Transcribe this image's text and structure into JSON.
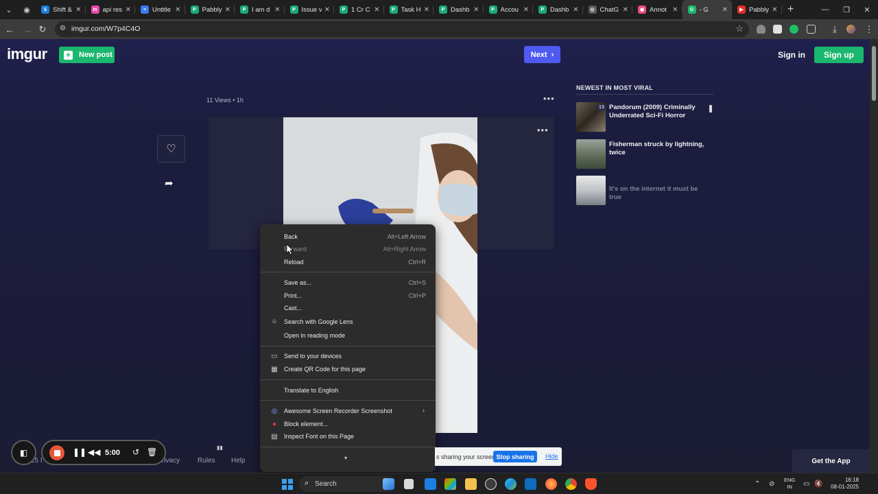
{
  "browser": {
    "tabs": [
      {
        "title": "Shift &",
        "icon_color": "#1b7cdc",
        "icon_letter": "S"
      },
      {
        "title": "api res",
        "icon_color": "#ea4aaa",
        "icon_letter": "m"
      },
      {
        "title": "Untitle",
        "icon_color": "#3b7af0",
        "icon_letter": "≡"
      },
      {
        "title": "Pabbly",
        "icon_color": "#1ba97a",
        "icon_letter": "P"
      },
      {
        "title": "I am d",
        "icon_color": "#1ba97a",
        "icon_letter": "P"
      },
      {
        "title": "Issue v",
        "icon_color": "#1ba97a",
        "icon_letter": "P"
      },
      {
        "title": "1 Cr C",
        "icon_color": "#1ba97a",
        "icon_letter": "P"
      },
      {
        "title": "Task H",
        "icon_color": "#1ba97a",
        "icon_letter": "P"
      },
      {
        "title": "Dashb",
        "icon_color": "#1ba97a",
        "icon_letter": "P"
      },
      {
        "title": "Accou",
        "icon_color": "#1ba97a",
        "icon_letter": "P"
      },
      {
        "title": "Dashb",
        "icon_color": "#1ba97a",
        "icon_letter": "P"
      },
      {
        "title": "ChatG",
        "icon_color": "#5c5c5c",
        "icon_letter": "◎"
      },
      {
        "title": "Annot",
        "icon_color": "#e84c8a",
        "icon_letter": "◉"
      },
      {
        "title": "- G",
        "icon_color": "#1bb76e",
        "icon_letter": "G",
        "active": true
      },
      {
        "title": "Pabbly",
        "icon_color": "#e52d27",
        "icon_letter": "▶"
      }
    ],
    "new_tab": "+",
    "url": "imgur.com/W7p4C4O"
  },
  "imgur": {
    "logo": "imgur",
    "new_post": "New post",
    "next": "Next",
    "sign_in": "Sign in",
    "sign_up": "Sign up",
    "post_meta": "11 Views • 1h",
    "more": "•••",
    "viral_heading": "NEWEST IN MOST VIRAL",
    "viral_items": [
      {
        "title": "Pandorum (2009) Criminally Underrated Sci-Fi Horror",
        "badge": "13"
      },
      {
        "title": "Fisherman struck by lightning, twice"
      },
      {
        "title": "It's on the internet it must be true"
      }
    ],
    "footer_links": [
      "…25 I",
      "rivacy",
      "Rules",
      "Help"
    ],
    "get_app": "Get the App"
  },
  "context_menu": {
    "items": [
      {
        "label": "Back",
        "shortcut": "Alt+Left Arrow"
      },
      {
        "label": "Forward",
        "shortcut": "Alt+Right Arrow",
        "disabled": true
      },
      {
        "label": "Reload",
        "shortcut": "Ctrl+R"
      },
      {
        "label": "Save as...",
        "shortcut": "Ctrl+S"
      },
      {
        "label": "Print...",
        "shortcut": "Ctrl+P"
      },
      {
        "label": "Cast..."
      },
      {
        "label": "Search with Google Lens",
        "icon": "lens-icon"
      },
      {
        "label": "Open in reading mode"
      },
      {
        "label": "Send to your devices",
        "icon": "devices-icon"
      },
      {
        "label": "Create QR Code for this page",
        "icon": "qr-icon"
      },
      {
        "label": "Translate to English"
      },
      {
        "label": "Awesome Screen Recorder  Screenshot",
        "icon": "recorder-icon"
      },
      {
        "label": "Block element...",
        "icon": "ublock-icon"
      },
      {
        "label": "Inspect Font on this Page",
        "icon": "font-icon"
      }
    ]
  },
  "recorder": {
    "time": "5:00"
  },
  "share_banner": {
    "message": "s sharing your screen.",
    "stop": "Stop sharing",
    "hide": "Hide"
  },
  "taskbar": {
    "search": "Search",
    "lang_top": "ENG",
    "lang_bottom": "IN",
    "time": "16:18",
    "date": "08-01-2025"
  }
}
